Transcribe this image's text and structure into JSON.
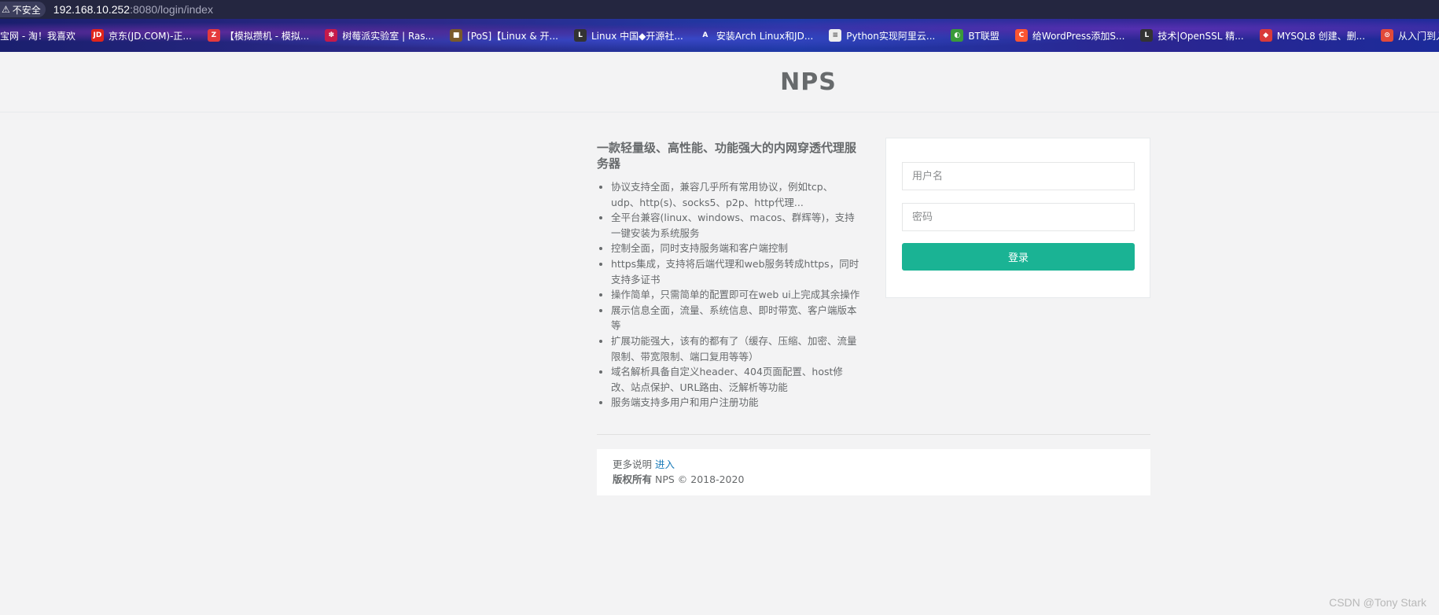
{
  "browser": {
    "security_label": "不安全",
    "url_host": "192.168.10.252",
    "url_path": ":8080/login/index"
  },
  "bookmarks": [
    {
      "label": "宝网 - 淘！我喜欢",
      "icon": "taobao-icon",
      "color": "transparent",
      "glyph": ""
    },
    {
      "label": "京东(JD.COM)-正...",
      "icon": "jd-icon",
      "color": "#e1251b",
      "glyph": "JD"
    },
    {
      "label": "【模拟攒机 - 模拟...",
      "icon": "zol-icon",
      "color": "#e43a3d",
      "glyph": "Z"
    },
    {
      "label": "树莓派实验室 | Ras...",
      "icon": "raspberry-icon",
      "color": "#c51a4a",
      "glyph": "✽"
    },
    {
      "label": "[PoS]【Linux & 开...",
      "icon": "pos-icon",
      "color": "#7a5a2a",
      "glyph": "■"
    },
    {
      "label": "Linux 中国◆开源社...",
      "icon": "linux-china-icon",
      "color": "#333333",
      "glyph": "L"
    },
    {
      "label": "安装Arch Linux和JD...",
      "icon": "arch-icon",
      "color": "transparent",
      "glyph": "A"
    },
    {
      "label": "Python实现阿里云...",
      "icon": "aliyun-icon",
      "color": "#eeeeee",
      "glyph": "≡"
    },
    {
      "label": "BT联盟",
      "icon": "bt-icon",
      "color": "#3a9a3a",
      "glyph": "◐"
    },
    {
      "label": "给WordPress添加S...",
      "icon": "csdn-icon",
      "color": "#fc5531",
      "glyph": "C"
    },
    {
      "label": "技术|OpenSSL 精...",
      "icon": "linux-china-icon-2",
      "color": "#333333",
      "glyph": "L"
    },
    {
      "label": "MYSQL8 创建、删...",
      "icon": "mysql-icon",
      "color": "#d93a3a",
      "glyph": "◆"
    },
    {
      "label": "从入门到入坟搭",
      "icon": "red-circle-icon",
      "color": "#e24a3a",
      "glyph": "⊙"
    }
  ],
  "header": {
    "title": "NPS"
  },
  "info": {
    "heading": "一款轻量级、高性能、功能强大的内网穿透代理服务器",
    "features": [
      "协议支持全面，兼容几乎所有常用协议，例如tcp、udp、http(s)、socks5、p2p、http代理...",
      "全平台兼容(linux、windows、macos、群辉等)，支持一键安装为系统服务",
      "控制全面，同时支持服务端和客户端控制",
      "https集成，支持将后端代理和web服务转成https，同时支持多证书",
      "操作简单，只需简单的配置即可在web ui上完成其余操作",
      "展示信息全面，流量、系统信息、即时带宽、客户端版本等",
      "扩展功能强大，该有的都有了（缓存、压缩、加密、流量限制、带宽限制、端口复用等等）",
      "域名解析具备自定义header、404页面配置、host修改、站点保护、URL路由、泛解析等功能",
      "服务端支持多用户和用户注册功能"
    ]
  },
  "login": {
    "username_placeholder": "用户名",
    "password_placeholder": "密码",
    "submit_label": "登录",
    "accent_color": "#1ab394"
  },
  "footer": {
    "more_text": "更多说明",
    "more_link": "进入",
    "copyright_label": "版权所有",
    "copyright_text": "NPS © 2018-2020"
  },
  "watermark": "CSDN @Tony Stark"
}
